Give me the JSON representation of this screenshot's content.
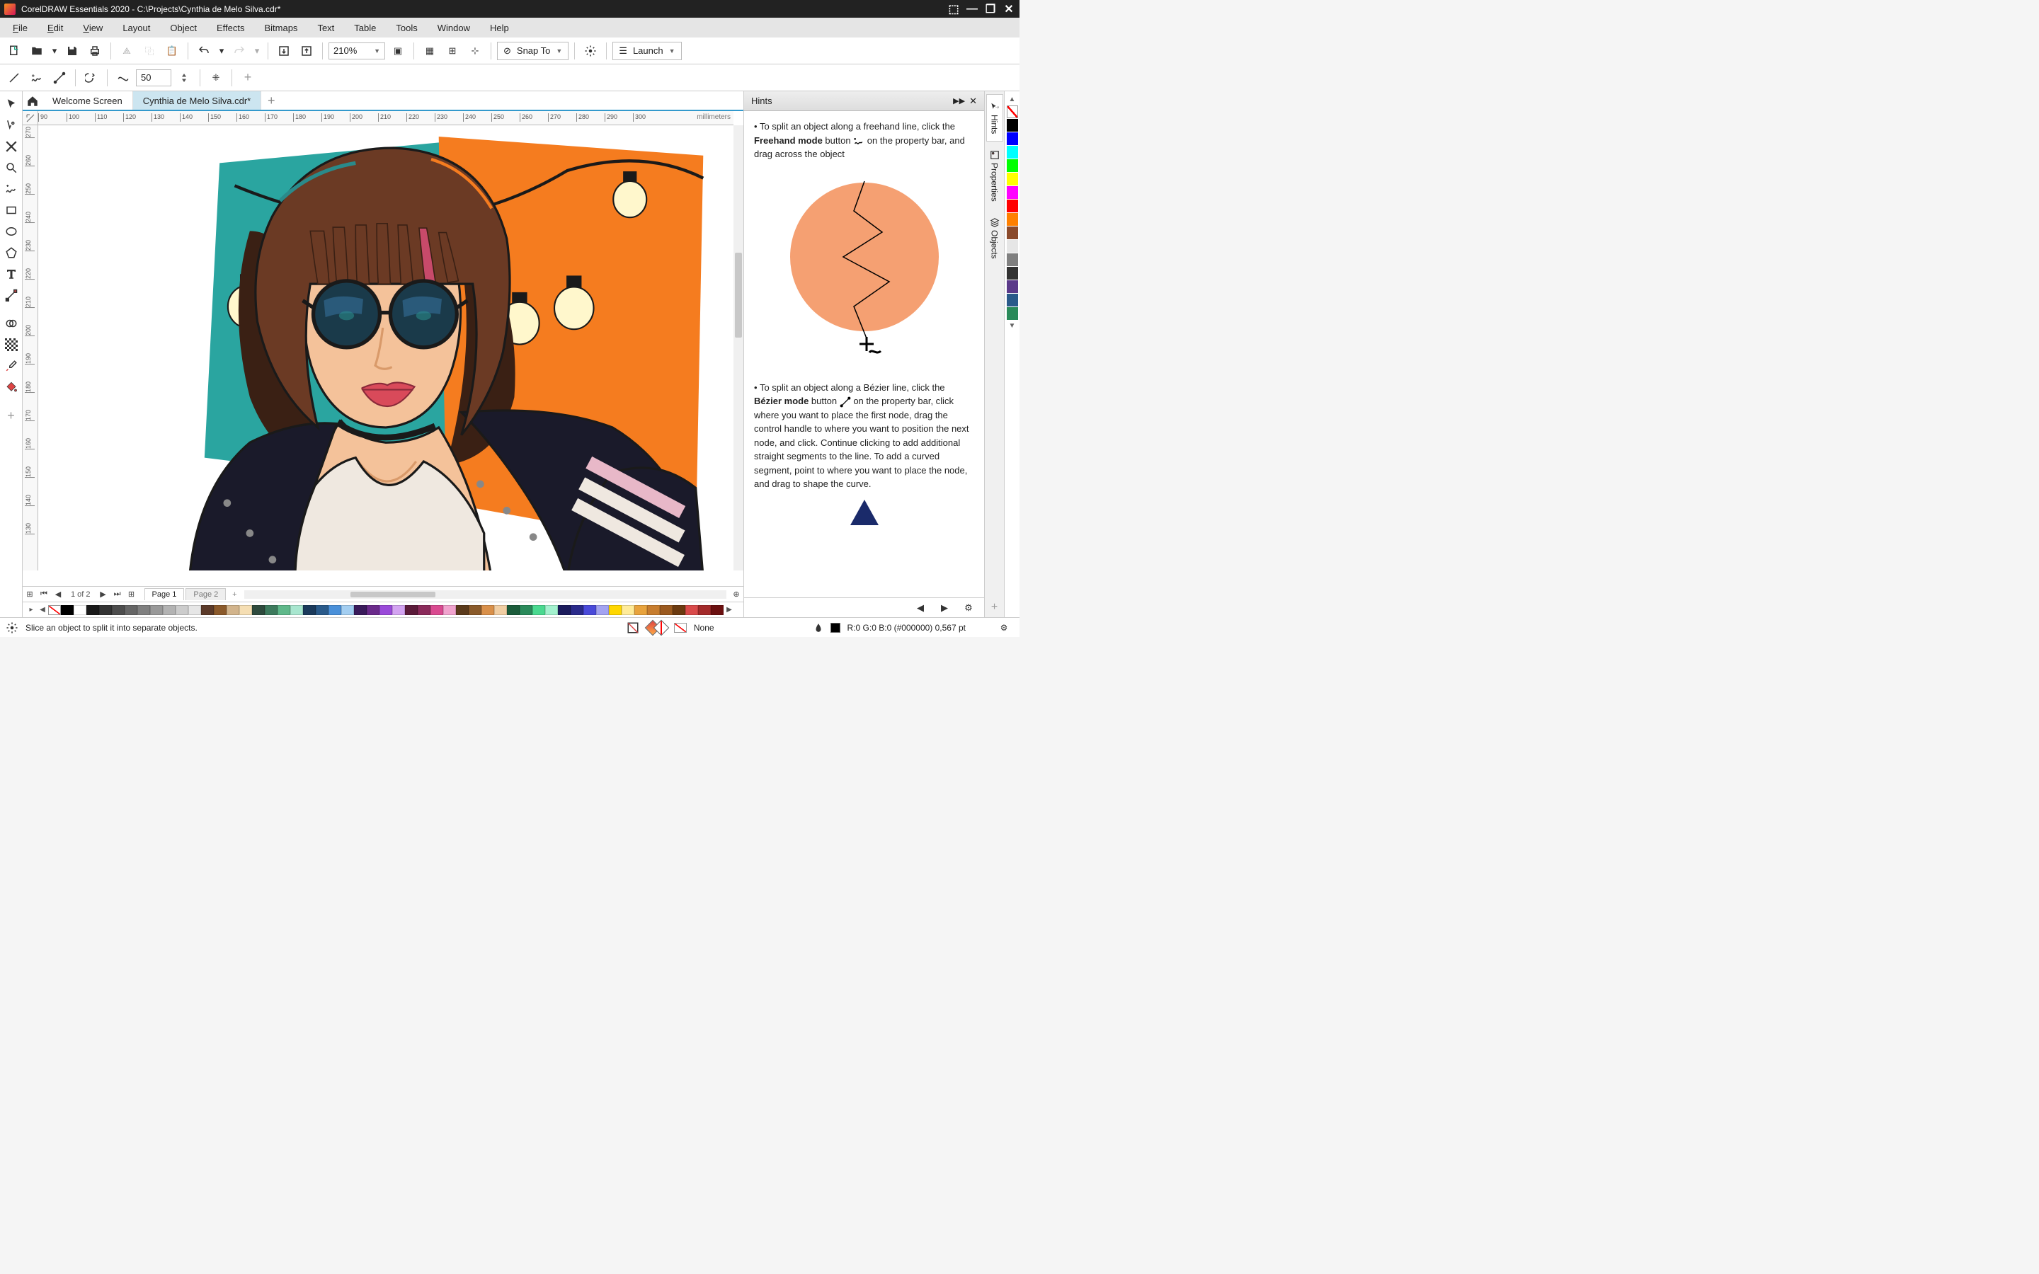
{
  "titlebar": {
    "app": "CorelDRAW Essentials 2020",
    "sep": " - ",
    "path": "C:\\Projects\\Cynthia de Melo Silva.cdr*"
  },
  "menu": {
    "file": "File",
    "edit": "Edit",
    "view": "View",
    "layout": "Layout",
    "object": "Object",
    "effects": "Effects",
    "bitmaps": "Bitmaps",
    "text": "Text",
    "table": "Table",
    "tools": "Tools",
    "window": "Window",
    "help": "Help"
  },
  "toolbar": {
    "zoom": "210%",
    "snap_to": "Snap To",
    "launch": "Launch"
  },
  "propertybar": {
    "freehand_smoothing": "50"
  },
  "tabs": {
    "home_icon": "home-icon",
    "welcome": "Welcome Screen",
    "doc": "Cynthia de Melo Silva.cdr*"
  },
  "ruler": {
    "units": "millimeters",
    "h_ticks": [
      "90",
      "100",
      "110",
      "120",
      "130",
      "140",
      "150",
      "160",
      "170",
      "180",
      "190",
      "200",
      "210",
      "220",
      "230",
      "240",
      "250",
      "260",
      "270",
      "280",
      "290",
      "300"
    ],
    "v_ticks": [
      "270",
      "260",
      "250",
      "240",
      "230",
      "220",
      "210",
      "200",
      "190",
      "180",
      "170",
      "160",
      "150",
      "140",
      "130"
    ]
  },
  "pages": {
    "current": "1 of 2",
    "page1": "Page 1",
    "page2": "Page 2"
  },
  "palette_row": [
    "#000000",
    "#ffffff",
    "#1a1a1a",
    "#333333",
    "#4d4d4d",
    "#666666",
    "#808080",
    "#999999",
    "#b3b3b3",
    "#cccccc",
    "#e6e6e6",
    "#5b3a29",
    "#8b5a2b",
    "#d2b48c",
    "#f5deb3",
    "#2e4a3d",
    "#3d7a5d",
    "#5fb88a",
    "#a8e6cf",
    "#1b3a5b",
    "#2a5a8a",
    "#4a90d9",
    "#a3cef1",
    "#3a1b5b",
    "#6a2a8a",
    "#9a4ad9",
    "#d3a3f1",
    "#5b1b3a",
    "#8a2a5a",
    "#d94a90",
    "#f1a3ce",
    "#5b3a1b",
    "#8a5a2a",
    "#d9904a",
    "#f1cea3",
    "#1b5b3a",
    "#2a8a5a",
    "#4ad990",
    "#a3f1ce",
    "#1b1b5b",
    "#2a2a8a",
    "#4a4ad9",
    "#a3a3f1",
    "#ffd700",
    "#ffeb99",
    "#e8a33d",
    "#c77d2e",
    "#9b5a1f",
    "#6b3a10",
    "#d94a4a",
    "#a32a2a",
    "#6b1010"
  ],
  "statusbar": {
    "tooltip": "Slice an object to split it into separate objects.",
    "fill_label": "None",
    "outline_info": "R:0 G:0 B:0 (#000000)  0,567 pt"
  },
  "hints": {
    "title": "Hints",
    "p1_pre": "To split an object along a freehand line, click the ",
    "p1_bold": "Freehand mode",
    "p1_mid": " button ",
    "p1_post": " on the property bar, and drag across the object",
    "p2_pre": "To split an object along a Bézier line, click the ",
    "p2_bold": "Bézier mode",
    "p2_mid": " button ",
    "p2_post": " on the property bar, click where you want to place the first node, drag the control handle to where you want to position the next node, and click. Continue clicking to add additional straight segments to the line. To add a curved segment, point to where you want to place the node, and drag to shape the curve."
  },
  "dockers": {
    "hints": "Hints",
    "properties": "Properties",
    "objects": "Objects"
  },
  "colorbar": [
    "#000000",
    "#0000ff",
    "#00ffff",
    "#00ff00",
    "#ffff00",
    "#ff00ff",
    "#ff0000",
    "#ff8000",
    "#8b4a2b",
    "#e6e6e6",
    "#808080",
    "#333333",
    "#5b3a8a",
    "#2a5a8a",
    "#2a8a5a"
  ],
  "artwork": {
    "bg_teal": "#2aa5a0",
    "bg_orange": "#f57c1f",
    "hair": "#6b3a24",
    "hair_dark": "#3a2014",
    "hair_highlight": "#2a8a8a",
    "hair_pink": "#c74a6a",
    "skin": "#f4c29a",
    "skin_shadow": "#d99a6a",
    "lips": "#d94a5a",
    "jacket": "#1a1a2a",
    "jacket_hi": "#3a3a5a",
    "shirt": "#efe8e0",
    "glasses": "#1a3a4a",
    "glass_hi": "#2a5a7a",
    "choker": "#1a1a1a",
    "bulb": "#fff7cc",
    "bulb_glow": "#fff1a8"
  }
}
